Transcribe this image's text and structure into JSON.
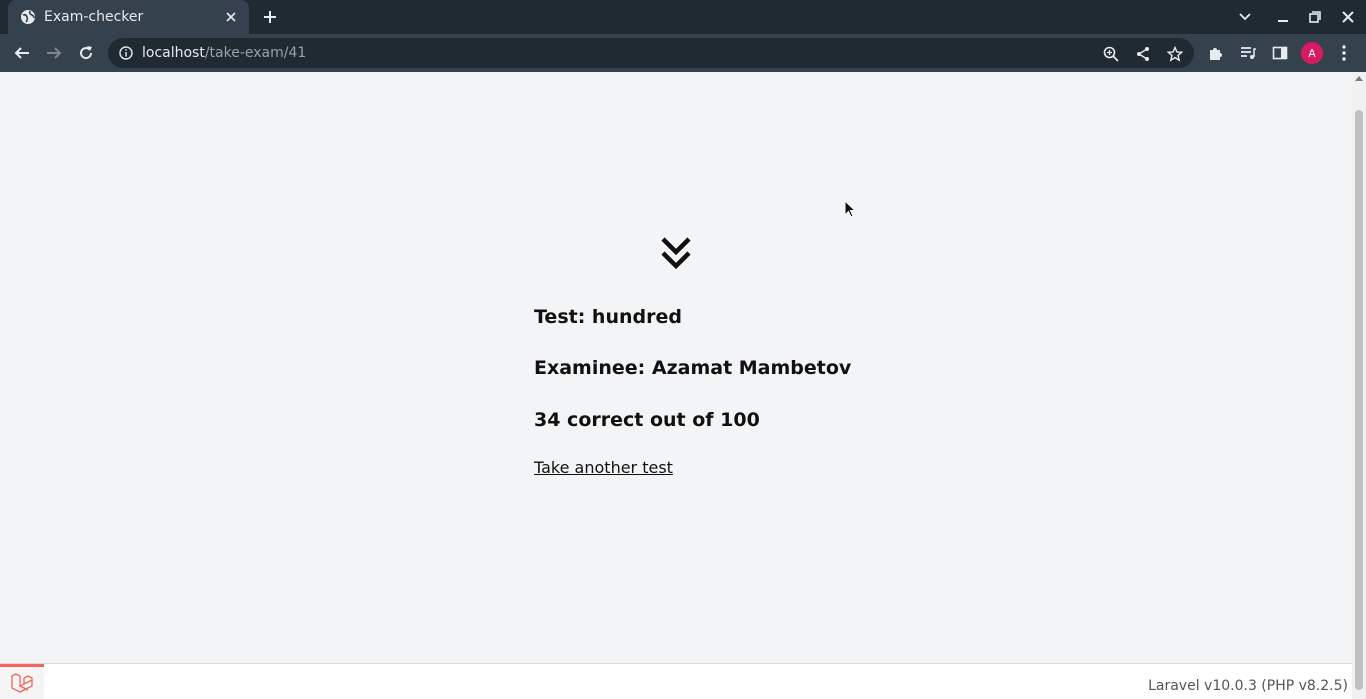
{
  "browser": {
    "tab_title": "Exam-checker",
    "url_host": "localhost",
    "url_path": "/take-exam/41",
    "profile_initial": "A",
    "icons": {
      "favicon": "globe-icon",
      "tab_close": "close-icon",
      "new_tab": "plus-icon",
      "tab_search": "chevron-down-icon",
      "minimize": "minimize-icon",
      "restore": "restore-icon",
      "close_window": "close-icon",
      "back": "arrow-left-icon",
      "forward": "arrow-right-icon",
      "reload": "reload-icon",
      "site_info": "info-icon",
      "zoom": "zoom-icon",
      "share": "share-icon",
      "bookmark": "star-icon",
      "extensions": "puzzle-icon",
      "media": "media-queue-icon",
      "side_panel": "side-panel-icon",
      "menu": "kebab-menu-icon"
    }
  },
  "result": {
    "test_line": "Test: hundred",
    "examinee_line": "Examinee: Azamat Mambetov",
    "score_line": "34 correct out of 100",
    "retake_link": "Take another test"
  },
  "debugbar": {
    "version": "Laravel v10.0.3 (PHP v8.2.5)"
  },
  "colors": {
    "page_background": "#f3f4f6",
    "tabstrip": "#202a33",
    "toolbar": "#35414c",
    "avatar": "#d81b60",
    "laravel_red": "#f4645f"
  }
}
